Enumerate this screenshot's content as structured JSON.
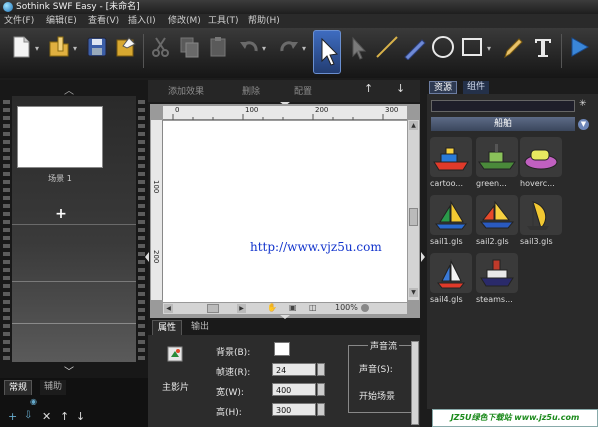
{
  "window": {
    "title": "Sothink SWF Easy - [未命名]"
  },
  "menu": [
    "文件(F)",
    "编辑(E)",
    "查看(V)",
    "插入(I)",
    "修改(M)",
    "工具(T)",
    "帮助(H)"
  ],
  "toolbar": {
    "icons": [
      "new-file-icon",
      "open-folder-icon",
      "save-icon",
      "publish-icon",
      "cut-icon",
      "copy-icon",
      "paste-icon",
      "undo-icon",
      "redo-icon",
      "select-arrow-icon",
      "subselect-icon",
      "line-icon",
      "pen-icon",
      "ellipse-icon",
      "rectangle-icon",
      "pencil-icon",
      "text-icon",
      "play-icon"
    ]
  },
  "stage_toolbar": {
    "add_effect": "添加效果",
    "delete": "删除",
    "configure": "配置"
  },
  "ruler": {
    "top_ticks": [
      "0",
      "100",
      "200",
      "300"
    ],
    "left_ticks": [
      "100",
      "200"
    ]
  },
  "zoom": "100%",
  "left_panel": {
    "scene_label": "场景 1",
    "tabs": [
      "常规",
      "辅助"
    ]
  },
  "properties": {
    "tabs": [
      "属性",
      "输出"
    ],
    "object_name": "主影片",
    "labels": {
      "background": "背景(B):",
      "frame_rate": "帧速(R):",
      "width": "宽(W):",
      "height": "高(H):"
    },
    "values": {
      "frame_rate": "24",
      "width": "400",
      "height": "300"
    },
    "sound_stream": "声音流",
    "sound": "声音(S):",
    "start_scene": "开始场景"
  },
  "right_panel": {
    "tabs": [
      "资源",
      "组件"
    ],
    "category": "船舶",
    "assets": [
      "cartoo...",
      "green...",
      "hoverc...",
      "sail1.gls",
      "sail2.gls",
      "sail3.gls",
      "sail4.gls",
      "steams..."
    ]
  },
  "overlay": {
    "watermark": "http://www.vjz5u.com",
    "site_banner": "JZ5U绿色下载站 www.jz5u.com"
  },
  "colors": {
    "chrome_dark": "#1c1c1c",
    "accent_blue": "#3a6fc4",
    "watermark": "#1133cc",
    "banner_green": "#1b8a1b"
  }
}
